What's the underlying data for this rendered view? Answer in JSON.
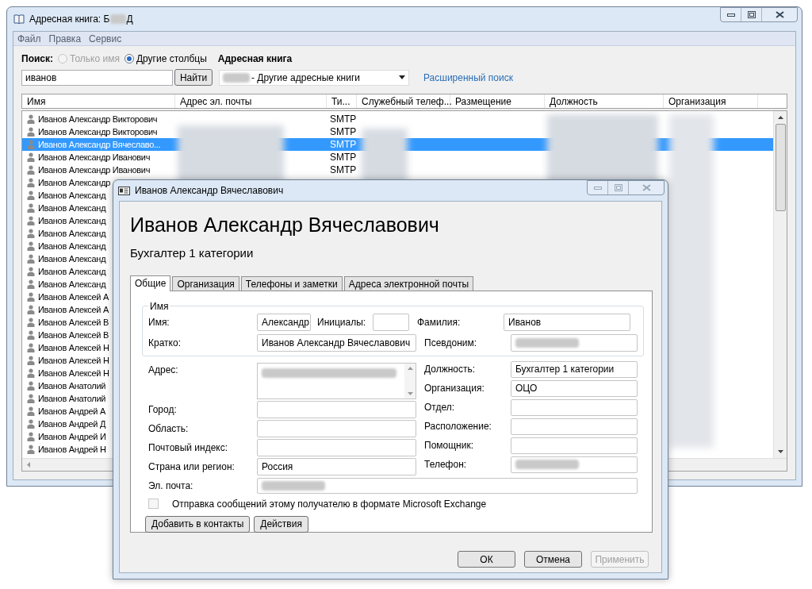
{
  "main_window": {
    "title_start": "Адресная книга: Б",
    "title_end": "Д"
  },
  "menu": [
    "Файл",
    "Правка",
    "Сервис"
  ],
  "search": {
    "label": "Поиск:",
    "options": [
      {
        "label": "Только имя",
        "selected": false,
        "disabled": true
      },
      {
        "label": "Другие столбцы",
        "selected": true,
        "disabled": false
      }
    ],
    "value": "иванов",
    "button": "Найти"
  },
  "address_book": {
    "label": "Адресная книга",
    "value": "- Другие адресные книги"
  },
  "advanced_search": "Расширенный поиск",
  "table": {
    "columns": [
      "Имя",
      "Адрес эл. почты",
      "Ти...",
      "Служебный телеф...",
      "Размещение",
      "Должность",
      "Организация"
    ],
    "rows": [
      {
        "name": "Иванов Александр Викторович",
        "type": "SMTP",
        "selected": false
      },
      {
        "name": "Иванов Александр Викторович",
        "type": "SMTP",
        "selected": false
      },
      {
        "name": "Иванов Александр Вячеславо...",
        "type": "SMTP",
        "selected": true
      },
      {
        "name": "Иванов Александр Иванович",
        "type": "SMTP",
        "selected": false
      },
      {
        "name": "Иванов Александр Иванович",
        "type": "SMTP",
        "selected": false
      },
      {
        "name": "Иванов Александр",
        "selected": false
      },
      {
        "name": "Иванов Александ",
        "selected": false
      },
      {
        "name": "Иванов Александ",
        "selected": false
      },
      {
        "name": "Иванов Александ",
        "selected": false
      },
      {
        "name": "Иванов Александ",
        "selected": false
      },
      {
        "name": "Иванов Александ",
        "selected": false
      },
      {
        "name": "Иванов Александ",
        "selected": false
      },
      {
        "name": "Иванов Александ",
        "selected": false
      },
      {
        "name": "Иванов Александ",
        "selected": false
      },
      {
        "name": "Иванов Алексей А",
        "selected": false
      },
      {
        "name": "Иванов Алексей А",
        "selected": false
      },
      {
        "name": "Иванов Алексей В",
        "selected": false
      },
      {
        "name": "Иванов Алексей В",
        "selected": false
      },
      {
        "name": "Иванов Алексей Н",
        "selected": false
      },
      {
        "name": "Иванов Алексей Н",
        "selected": false
      },
      {
        "name": "Иванов Алексей Н",
        "selected": false
      },
      {
        "name": "Иванов Анатолий",
        "selected": false
      },
      {
        "name": "Иванов Анатолий",
        "selected": false
      },
      {
        "name": "Иванов Андрей А",
        "selected": false
      },
      {
        "name": "Иванов Андрей Д",
        "selected": false
      },
      {
        "name": "Иванов Андрей И",
        "selected": false
      },
      {
        "name": "Иванов Андрей Н",
        "selected": false
      }
    ]
  },
  "dialog": {
    "title": "Иванов Александр Вячеславович",
    "heading": "Иванов Александр Вячеславович",
    "subtitle": "Бухгалтер 1 категории",
    "tabs": [
      {
        "label": "Общие",
        "selected": true
      },
      {
        "label": "Организация",
        "selected": false
      },
      {
        "label": "Телефоны и заметки",
        "selected": false
      },
      {
        "label": "Адреса электронной почты",
        "selected": false
      }
    ],
    "name_group": {
      "title": "Имя",
      "fields": [
        {
          "label": "Имя:",
          "value": "Александр",
          "redacted": false
        },
        {
          "label": "Инициалы:",
          "redacted": false
        },
        {
          "label": "Фамилия:",
          "value": "Иванов",
          "redacted": false
        },
        {
          "label": "Кратко:",
          "value": "Иванов Александр Вячеславович",
          "redacted": false
        },
        {
          "label": "Псевдоним:",
          "redacted": true
        }
      ]
    },
    "left_fields": [
      {
        "kind": "textarea",
        "label": "Адрес:",
        "redacted": true
      },
      {
        "kind": "text",
        "label": "Город:",
        "redacted": false
      },
      {
        "kind": "text",
        "label": "Область:",
        "redacted": false
      },
      {
        "kind": "text",
        "label": "Почтовый индекс:",
        "redacted": false
      },
      {
        "kind": "text",
        "label": "Страна или регион:",
        "value": "Россия",
        "redacted": false
      }
    ],
    "right_fields": [
      {
        "label": "Должность:",
        "value": "Бухгалтер 1 категории",
        "redacted": false
      },
      {
        "label": "Организация:",
        "value": "ОЦО",
        "redacted": false
      },
      {
        "label": "Отдел:",
        "redacted": false
      },
      {
        "label": "Расположение:",
        "redacted": false
      },
      {
        "label": "Помощник:",
        "redacted": false
      },
      {
        "label": "Телефон:",
        "redacted": true
      }
    ],
    "email": {
      "label": "Эл. почта:",
      "redacted": true
    },
    "exchange_checkbox": {
      "label": "Отправка сообщений этому получателю в формате Microsoft Exchange",
      "checked": false
    },
    "actions": [
      "Добавить в контакты",
      "Действия"
    ],
    "buttons": [
      {
        "label": "ОК",
        "disabled": false
      },
      {
        "label": "Отмена",
        "disabled": false
      },
      {
        "label": "Применить",
        "disabled": true
      }
    ]
  }
}
